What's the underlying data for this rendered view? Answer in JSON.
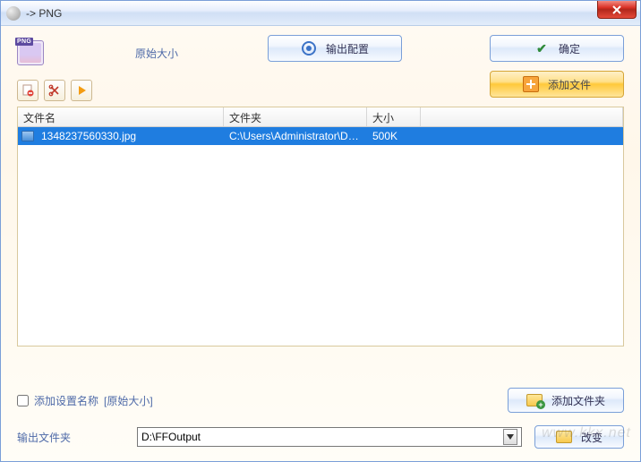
{
  "window": {
    "title": "-> PNG"
  },
  "topbar": {
    "original_size_label": "原始大小",
    "output_config_label": "输出配置",
    "ok_label": "确定",
    "add_file_label": "添加文件"
  },
  "table": {
    "headers": {
      "name": "文件名",
      "folder": "文件夹",
      "size": "大小"
    },
    "rows": [
      {
        "name": "1348237560330.jpg",
        "folder": "C:\\Users\\Administrator\\Des...",
        "size": "500K"
      }
    ]
  },
  "bottom": {
    "add_setting_label": "添加设置名称",
    "setting_value": "[原始大小]",
    "output_folder_label": "输出文件夹",
    "output_folder_value": "D:\\FFOutput",
    "add_folder_label": "添加文件夹",
    "change_label": "改变"
  },
  "watermark": "www.kkx.net"
}
